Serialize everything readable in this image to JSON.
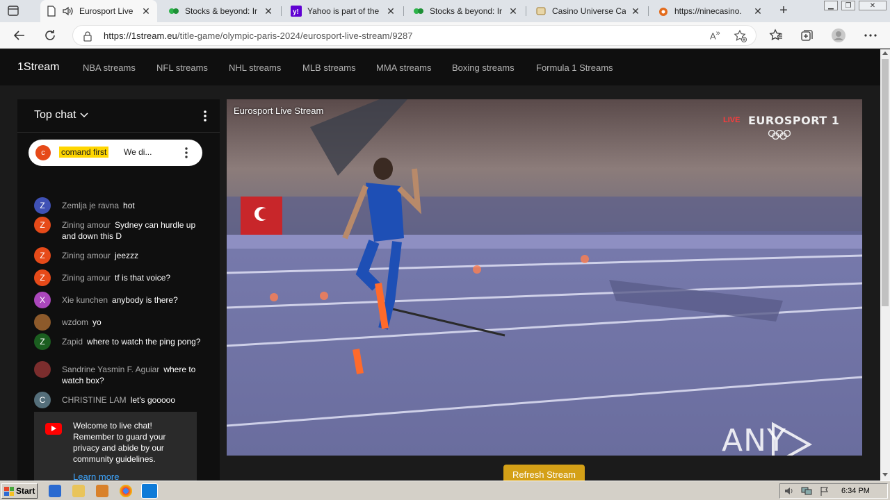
{
  "browser": {
    "tabs": [
      {
        "title": "Eurosport Live",
        "favicon": "page-icon",
        "active": true,
        "audio": true
      },
      {
        "title": "Stocks & beyond: Ir",
        "favicon": "green-logo-icon"
      },
      {
        "title": "Yahoo is part of the",
        "favicon": "yahoo-icon"
      },
      {
        "title": "Stocks & beyond: Ir",
        "favicon": "green-logo-icon"
      },
      {
        "title": "Casino Universe Ca",
        "favicon": "casino-icon"
      },
      {
        "title": "https://ninecasino.",
        "favicon": "ninecasino-icon"
      }
    ],
    "url_host": "https://1stream.eu",
    "url_path": "/title-game/olympic-paris-2024/eurosport-live-stream/9287"
  },
  "site": {
    "brand": "1Stream",
    "nav": [
      "NBA streams",
      "NFL streams",
      "NHL streams",
      "MLB streams",
      "MMA streams",
      "Boxing streams",
      "Formula 1 Streams"
    ]
  },
  "chat": {
    "title": "Top chat",
    "pinned": {
      "avatar": "c",
      "author": "comand first",
      "message": "We di..."
    },
    "messages": [
      {
        "initial": "Z",
        "color": "#3f51b5",
        "author": "Zemlja je ravna",
        "text": "hot"
      },
      {
        "initial": "Z",
        "color": "#e64a19",
        "author": "Zining amour",
        "text": "Sydney can hurdle up and down this D"
      },
      {
        "initial": "Z",
        "color": "#e64a19",
        "author": "Zining amour",
        "text": "jeezzz"
      },
      {
        "initial": "Z",
        "color": "#e64a19",
        "author": "Zining amour",
        "text": "tf is that voice?"
      },
      {
        "initial": "X",
        "color": "#ab47bc",
        "author": "Xie kunchen",
        "text": "anybody is there?"
      },
      {
        "initial": "",
        "color": "#8d5a2b",
        "author": "wzdom",
        "text": "yo"
      },
      {
        "initial": "Z",
        "color": "#1b5e20",
        "author": "Zapid",
        "text": "where to watch the ping pong?"
      },
      {
        "initial": "",
        "color": "#7b2d2d",
        "author": "Sandrine Yasmin F. Aguiar",
        "text": "where to watch box?"
      },
      {
        "initial": "C",
        "color": "#546e7a",
        "author": "CHRISTINE LAM",
        "text": "let's gooooo"
      }
    ],
    "welcome": {
      "text": "Welcome to live chat! Remember to guard your privacy and abide by our community guidelines.",
      "link": "Learn more"
    }
  },
  "player": {
    "title": "Eurosport Live Stream",
    "live_label": "LIVE",
    "channel": "EUROSPORT 1",
    "watermark": "ANY RUN"
  },
  "refresh_label": "Refresh Stream",
  "taskbar": {
    "start": "Start",
    "clock": "6:34 PM"
  }
}
